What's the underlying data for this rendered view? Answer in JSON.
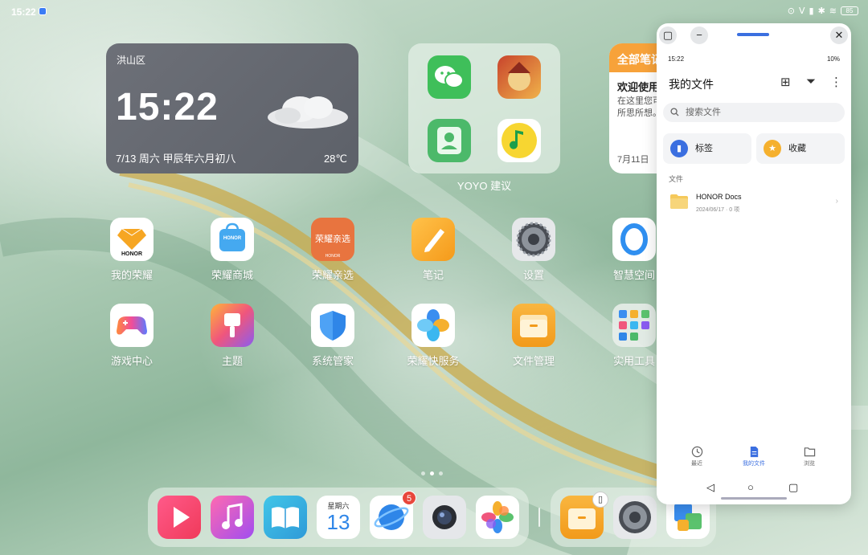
{
  "status": {
    "time": "15:22",
    "battery": "85"
  },
  "clock_widget": {
    "district": "洪山区",
    "time": "15:22",
    "date": "7/13 周六 甲辰年六月初八",
    "temperature": "28℃"
  },
  "yoyo": {
    "label": "YOYO 建议",
    "apps": [
      "wechat-icon",
      "game-icon",
      "contacts-icon",
      "music-icon"
    ]
  },
  "notes_widget": {
    "header": "全部笔记",
    "title": "欢迎使用",
    "line1": "在这里您可",
    "line2": "所思所想。",
    "date": "7月11日"
  },
  "apps_row1": [
    {
      "label": "我的荣耀",
      "icon": "honor-diamond-icon"
    },
    {
      "label": "荣耀商城",
      "icon": "honor-store-icon"
    },
    {
      "label": "荣耀亲选",
      "icon": "honor-select-icon"
    },
    {
      "label": "笔记",
      "icon": "notes-icon"
    },
    {
      "label": "设置",
      "icon": "settings-icon"
    },
    {
      "label": "智慧空间",
      "icon": "smart-space-icon"
    }
  ],
  "apps_row2": [
    {
      "label": "游戏中心",
      "icon": "gamepad-icon"
    },
    {
      "label": "主题",
      "icon": "theme-brush-icon"
    },
    {
      "label": "系统管家",
      "icon": "shield-icon"
    },
    {
      "label": "荣耀快服务",
      "icon": "quick-service-icon"
    },
    {
      "label": "文件管理",
      "icon": "folder-icon"
    },
    {
      "label": "实用工具",
      "icon": "tools-folder-icon"
    }
  ],
  "icon_texts": {
    "honor": "HONOR",
    "select": "荣耀亲选",
    "calendar_weekday": "星期六",
    "calendar_day": "13"
  },
  "dock": {
    "browser_badge": "5"
  },
  "file_window": {
    "status_time": "15:22",
    "status_battery": "10%",
    "title": "我的文件",
    "search_placeholder": "搜索文件",
    "card_tags": "标签",
    "card_favorites": "收藏",
    "section_files": "文件",
    "folder_name": "HONOR Docs",
    "folder_meta": "2024/06/17 · 0 项",
    "nav_recent": "最近",
    "nav_myfiles": "我的文件",
    "nav_browse": "浏览"
  },
  "colors": {
    "accent": "#3b6fe0",
    "notes_orange": "#f7a23a",
    "badge_red": "#e8473c"
  }
}
